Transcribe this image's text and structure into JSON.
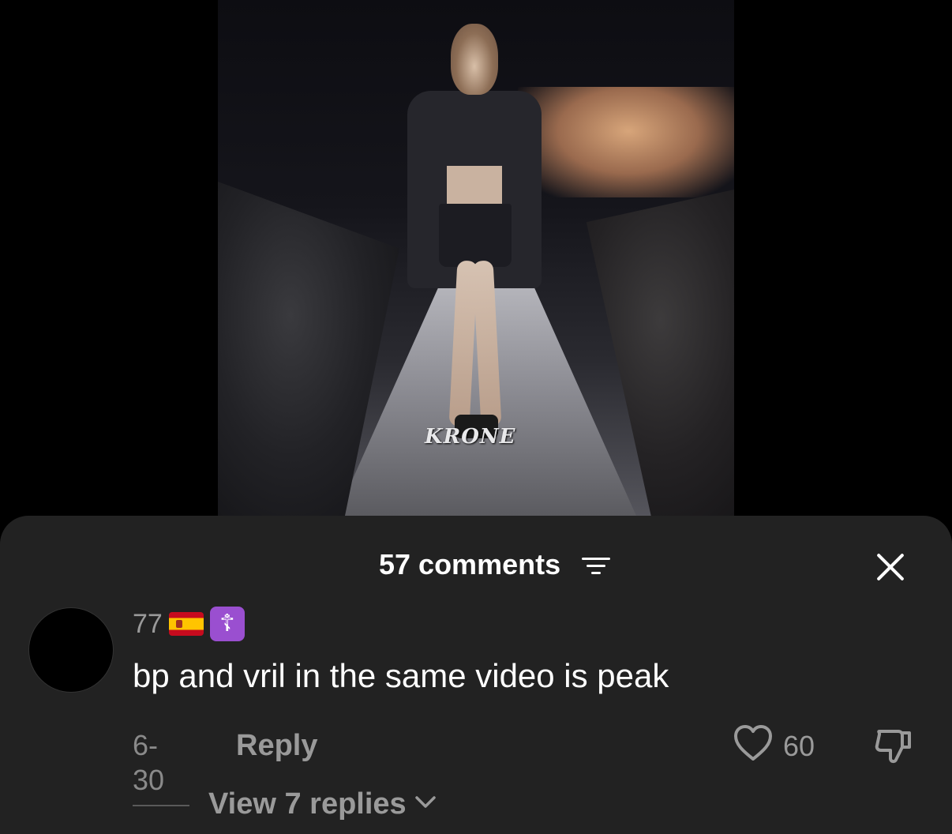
{
  "video": {
    "caption": "KRONE"
  },
  "sheet": {
    "comments_count": "57 comments",
    "sort_icon": "sort-lines-icon",
    "close_icon": "close-icon"
  },
  "comment": {
    "username": "77",
    "badges": [
      "flag-spain-icon",
      "orthodox-cross-icon"
    ],
    "cross_glyph": "☦",
    "text": "bp and vril in the same video is peak",
    "date": "6-30",
    "reply_label": "Reply",
    "likes": "60",
    "view_replies_label": "View 7 replies"
  },
  "colors": {
    "sheet_bg": "#222222",
    "muted_text": "#9a9a9a",
    "primary_text": "#ffffff",
    "badge_purple": "#9a4fd0"
  }
}
